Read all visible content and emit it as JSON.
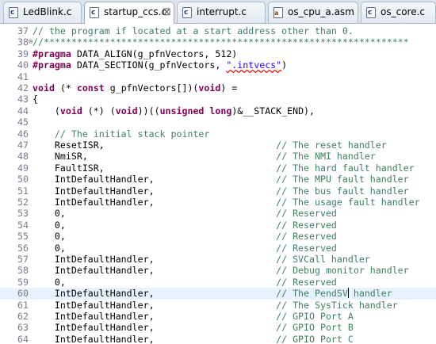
{
  "tabs": [
    {
      "label": "LedBlink.c",
      "icon": "c-file-icon"
    },
    {
      "label": "startup_ccs.c",
      "icon": "c-file-icon",
      "active": true,
      "close": "⊠"
    },
    {
      "label": "interrupt.c",
      "icon": "c-file-icon"
    },
    {
      "label": "os_cpu_a.asm",
      "icon": "asm-file-icon"
    },
    {
      "label": "os_core.c",
      "icon": "c-file-icon"
    }
  ],
  "editor": {
    "lines": [
      {
        "n": "37",
        "segs": [
          {
            "t": "cmt",
            "v": "// the program if located at a start address other than 0."
          }
        ]
      },
      {
        "n": "38",
        "fold": "⊖",
        "segs": [
          {
            "t": "cmt",
            "v": "//******************************************************************"
          }
        ]
      },
      {
        "n": "39",
        "segs": [
          {
            "t": "kw",
            "v": "#pragma"
          },
          {
            "t": "plain",
            "v": " DATA_ALIGN(g_pfnVectors, 512)"
          }
        ]
      },
      {
        "n": "40",
        "segs": [
          {
            "t": "kw",
            "v": "#pragma"
          },
          {
            "t": "plain",
            "v": " DATA_SECTION(g_pfnVectors, "
          },
          {
            "t": "str",
            "v": "\".intvecs\""
          },
          {
            "t": "plain",
            "v": ")"
          }
        ]
      },
      {
        "n": "41",
        "segs": []
      },
      {
        "n": "42",
        "segs": [
          {
            "t": "kw",
            "v": "void"
          },
          {
            "t": "plain",
            "v": " (* "
          },
          {
            "t": "kw",
            "v": "const"
          },
          {
            "t": "plain",
            "v": " g_pfnVectors[])("
          },
          {
            "t": "kw",
            "v": "void"
          },
          {
            "t": "plain",
            "v": ") ="
          }
        ]
      },
      {
        "n": "43",
        "segs": [
          {
            "t": "plain",
            "v": "{"
          }
        ]
      },
      {
        "n": "44",
        "segs": [
          {
            "t": "plain",
            "v": "    ("
          },
          {
            "t": "kw",
            "v": "void"
          },
          {
            "t": "plain",
            "v": " (*) ("
          },
          {
            "t": "kw",
            "v": "void"
          },
          {
            "t": "plain",
            "v": "))(("
          },
          {
            "t": "kw",
            "v": "unsigned long"
          },
          {
            "t": "plain",
            "v": ")&__STACK_END),"
          }
        ]
      },
      {
        "n": "45",
        "segs": []
      },
      {
        "n": "46",
        "segs": [
          {
            "t": "cmt",
            "v": "    // The initial stack pointer"
          }
        ]
      },
      {
        "n": "47",
        "segs": [
          {
            "t": "plain",
            "v": "    ResetISR,                               "
          },
          {
            "t": "cmt",
            "v": "// The reset handler"
          }
        ]
      },
      {
        "n": "48",
        "segs": [
          {
            "t": "plain",
            "v": "    NmiSR,                                  "
          },
          {
            "t": "cmt",
            "v": "// The NMI handler"
          }
        ]
      },
      {
        "n": "49",
        "segs": [
          {
            "t": "plain",
            "v": "    FaultISR,                               "
          },
          {
            "t": "cmt",
            "v": "// The hard fault handler"
          }
        ]
      },
      {
        "n": "50",
        "segs": [
          {
            "t": "plain",
            "v": "    IntDefaultHandler,                      "
          },
          {
            "t": "cmt",
            "v": "// The MPU fault handler"
          }
        ]
      },
      {
        "n": "51",
        "segs": [
          {
            "t": "plain",
            "v": "    IntDefaultHandler,                      "
          },
          {
            "t": "cmt",
            "v": "// The bus fault handler"
          }
        ]
      },
      {
        "n": "52",
        "segs": [
          {
            "t": "plain",
            "v": "    IntDefaultHandler,                      "
          },
          {
            "t": "cmt",
            "v": "// The usage fault handler"
          }
        ]
      },
      {
        "n": "53",
        "segs": [
          {
            "t": "plain",
            "v": "    0,                                      "
          },
          {
            "t": "cmt",
            "v": "// Reserved"
          }
        ]
      },
      {
        "n": "54",
        "segs": [
          {
            "t": "plain",
            "v": "    0,                                      "
          },
          {
            "t": "cmt",
            "v": "// Reserved"
          }
        ]
      },
      {
        "n": "55",
        "segs": [
          {
            "t": "plain",
            "v": "    0,                                      "
          },
          {
            "t": "cmt",
            "v": "// Reserved"
          }
        ]
      },
      {
        "n": "56",
        "segs": [
          {
            "t": "plain",
            "v": "    0,                                      "
          },
          {
            "t": "cmt",
            "v": "// Reserved"
          }
        ]
      },
      {
        "n": "57",
        "segs": [
          {
            "t": "plain",
            "v": "    IntDefaultHandler,                      "
          },
          {
            "t": "cmt",
            "v": "// SVCall handler"
          }
        ]
      },
      {
        "n": "58",
        "segs": [
          {
            "t": "plain",
            "v": "    IntDefaultHandler,                      "
          },
          {
            "t": "cmt",
            "v": "// Debug monitor handler"
          }
        ]
      },
      {
        "n": "59",
        "segs": [
          {
            "t": "plain",
            "v": "    0,                                      "
          },
          {
            "t": "cmt",
            "v": "// Reserved"
          }
        ]
      },
      {
        "n": "60",
        "hl": true,
        "segs": [
          {
            "t": "plain",
            "v": "    IntDefaultHandler,                      "
          },
          {
            "t": "cmt",
            "v": "// The PendSV"
          },
          {
            "t": "cursor",
            "v": ""
          },
          {
            "t": "cmt",
            "v": " handler"
          }
        ]
      },
      {
        "n": "61",
        "segs": [
          {
            "t": "plain",
            "v": "    IntDefaultHandler,                      "
          },
          {
            "t": "cmt",
            "v": "// The SysTick handler"
          }
        ]
      },
      {
        "n": "62",
        "segs": [
          {
            "t": "plain",
            "v": "    IntDefaultHandler,                      "
          },
          {
            "t": "cmt",
            "v": "// GPIO Port A"
          }
        ]
      },
      {
        "n": "63",
        "segs": [
          {
            "t": "plain",
            "v": "    IntDefaultHandler,                      "
          },
          {
            "t": "cmt",
            "v": "// GPIO Port B"
          }
        ]
      },
      {
        "n": "64",
        "segs": [
          {
            "t": "plain",
            "v": "    IntDefaultHandler,                      "
          },
          {
            "t": "cmt",
            "v": "// GPIO Port C"
          }
        ]
      }
    ]
  }
}
